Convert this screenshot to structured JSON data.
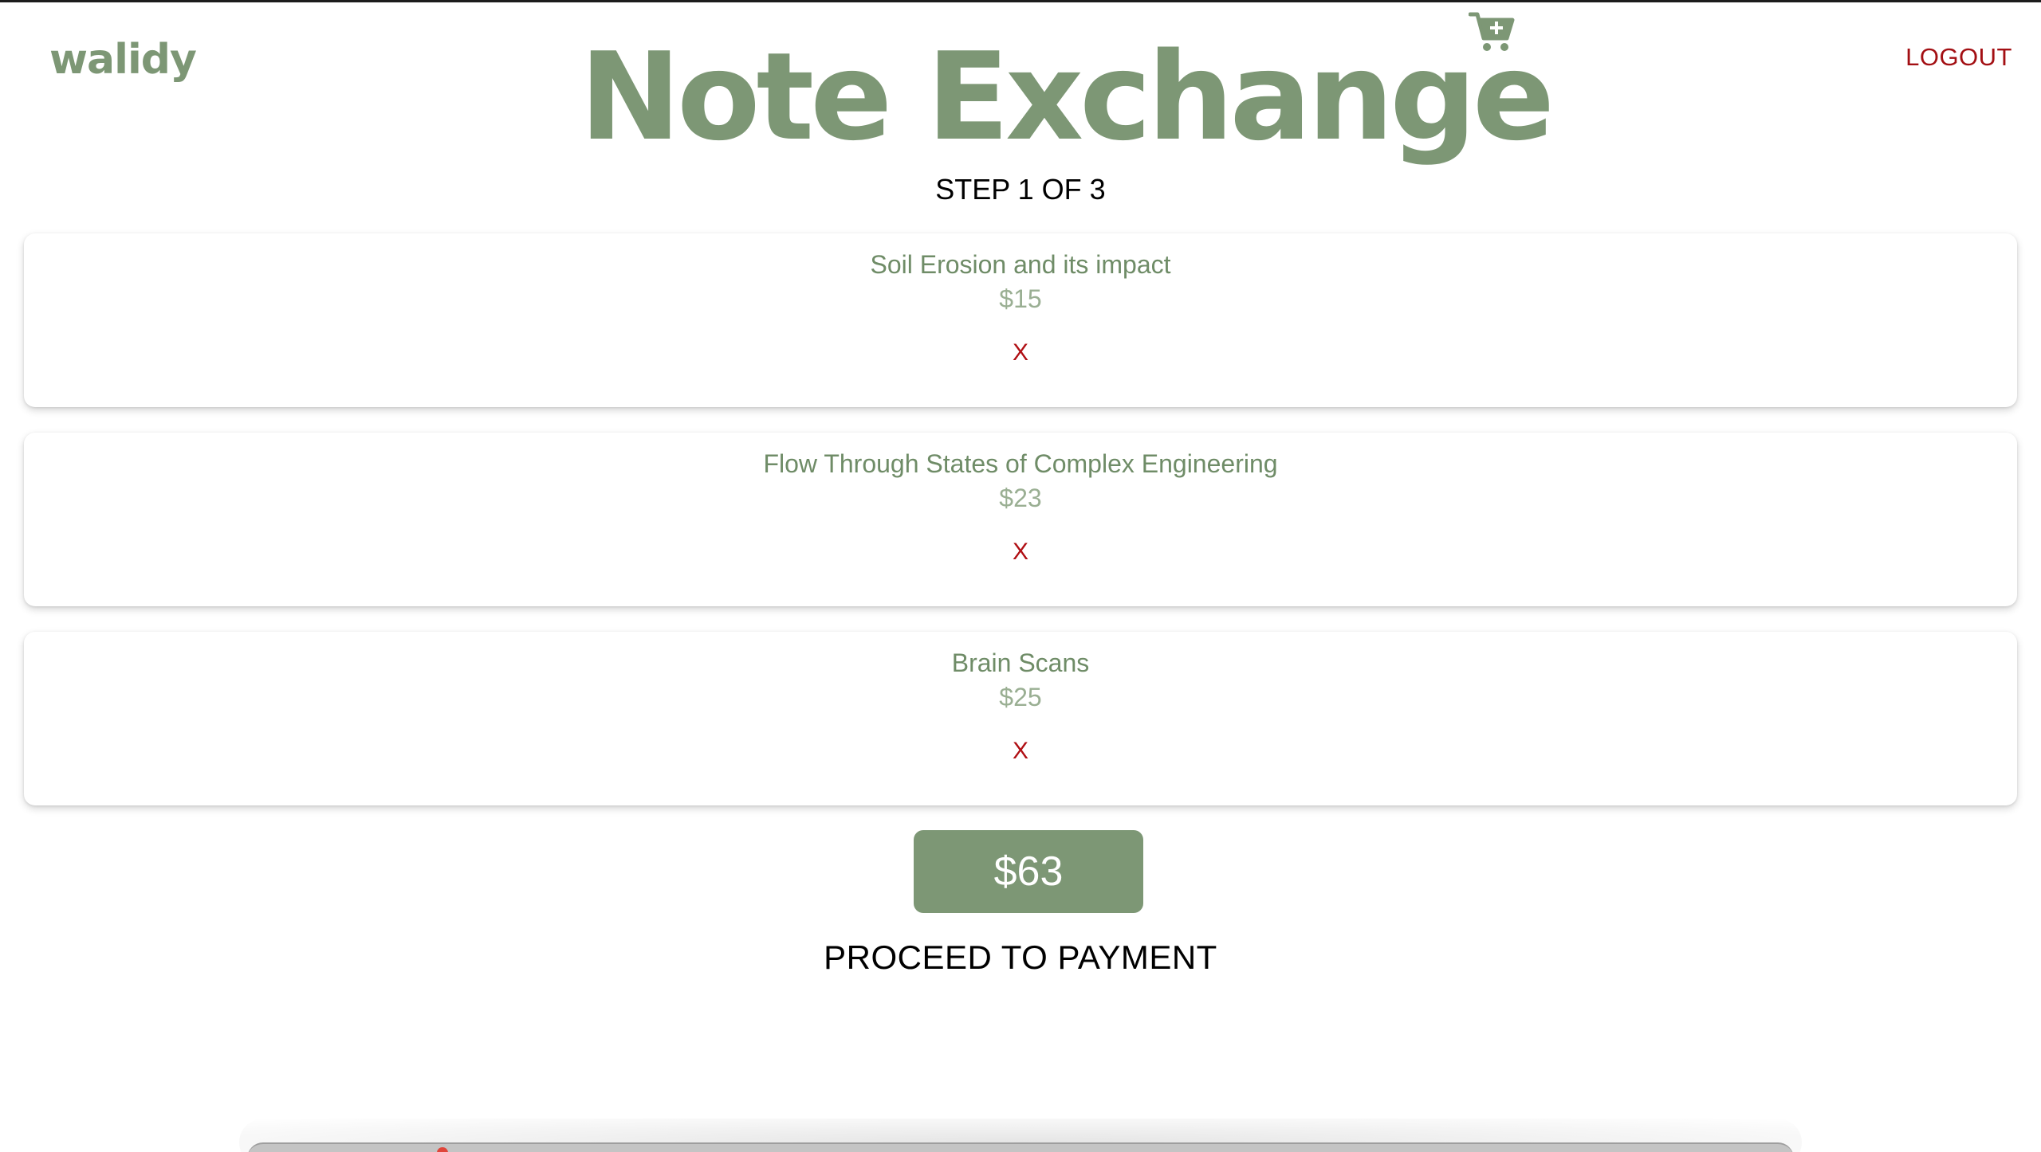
{
  "header": {
    "brand": "walidy",
    "title": "Note Exchange",
    "logout_label": "LOGOUT",
    "cart_icon": "cart-plus-icon"
  },
  "checkout": {
    "step_label": "STEP 1 OF 3",
    "items": [
      {
        "title": "Soil Erosion and its impact",
        "price": "$15",
        "remove_label": "X"
      },
      {
        "title": "Flow Through States of Complex Engineering",
        "price": "$23",
        "remove_label": "X"
      },
      {
        "title": "Brain Scans",
        "price": "$25",
        "remove_label": "X"
      }
    ],
    "total": "$63",
    "proceed_label": "PROCEED TO PAYMENT"
  },
  "colors": {
    "brand_green": "#7d9775",
    "title_green": "#6f8c67",
    "price_green": "#9aaf93",
    "remove_red": "#b00f14",
    "logout_red": "#a30f13",
    "text_black": "#000000"
  }
}
